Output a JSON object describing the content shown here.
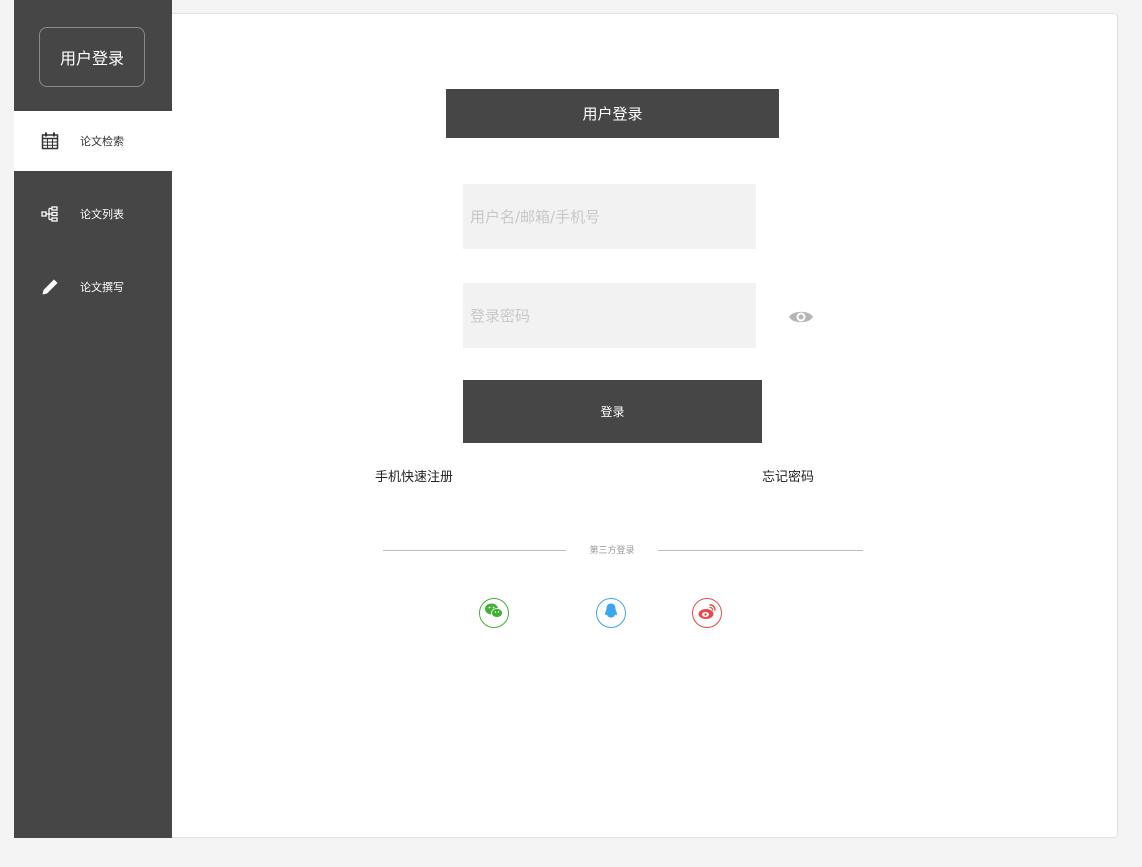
{
  "sidebar": {
    "header": "用户登录",
    "items": [
      {
        "label": "论文检索",
        "icon": "calendar-icon",
        "active": true
      },
      {
        "label": "论文列表",
        "icon": "tree-structure-icon",
        "active": false
      },
      {
        "label": "论文撰写",
        "icon": "pencil-icon",
        "active": false
      }
    ]
  },
  "login": {
    "title": "用户登录",
    "username_placeholder": "用户名/邮箱/手机号",
    "password_placeholder": "登录密码",
    "submit_label": "登录",
    "register_link": "手机快速注册",
    "forgot_link": "忘记密码",
    "third_party_label": "第三方登录"
  },
  "social": [
    {
      "name": "wechat-icon",
      "color": "#41b035"
    },
    {
      "name": "qq-icon",
      "color": "#3aa6f0"
    },
    {
      "name": "weibo-icon",
      "color": "#e84a4a"
    }
  ],
  "colors": {
    "sidebar_bg": "#464646",
    "dark_button": "#464646",
    "field_bg": "#f2f2f2"
  }
}
